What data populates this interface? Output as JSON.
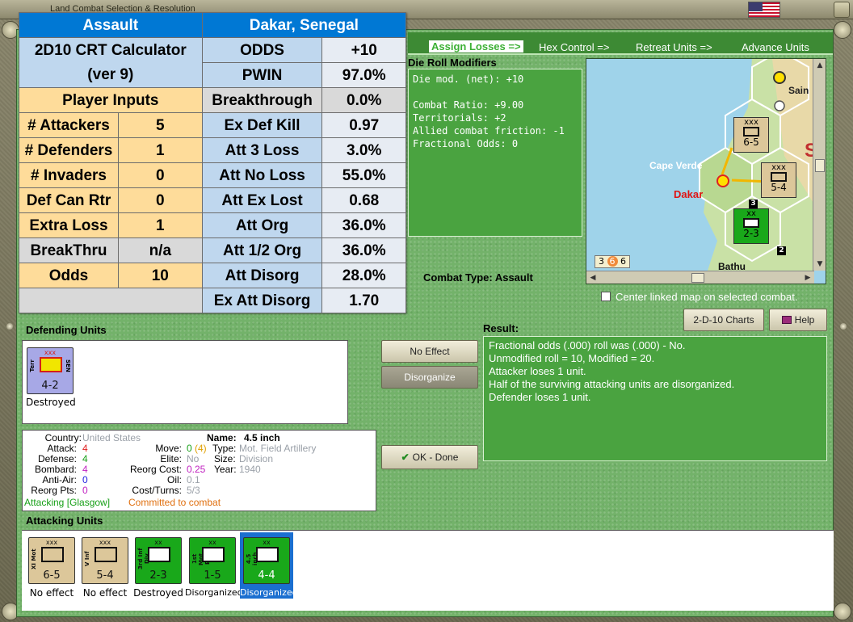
{
  "window": {
    "title": "Land Combat Selection & Resolution"
  },
  "steps": [
    {
      "label": "Assign Losses =>",
      "active": true
    },
    {
      "label": "Hex Control =>",
      "active": false
    },
    {
      "label": "Retreat Units =>",
      "active": false
    },
    {
      "label": "Advance Units",
      "active": false
    }
  ],
  "die_roll": {
    "heading": "Die Roll Modifiers",
    "lines": [
      "Die mod. (net): +10",
      "",
      "Combat Ratio: +9.00",
      "Territorials: +2",
      "Allied combat friction: -1",
      "Fractional Odds: 0"
    ]
  },
  "map": {
    "city_main": "Dakar",
    "city_island": "Cape Verde",
    "city_top": "Sain",
    "city_bottom": "Bathu",
    "big_letter": "S",
    "stack_left": "3",
    "stack_mid": "6",
    "stack_right": "6",
    "counter_a_size": "xxx",
    "counter_a_str": "6-5",
    "counter_b_size": "xxx",
    "counter_b_str": "5-4",
    "counter_c_size": "xx",
    "counter_c_str": "2-3",
    "marker_3": "3",
    "marker_2": "2"
  },
  "combat_type": "Combat Type:  Assault",
  "center_link_label": "Center linked map on selected combat.",
  "buttons": {
    "charts": "2-D-10 Charts",
    "help": "Help",
    "no_effect": "No Effect",
    "disorganize": "Disorganize",
    "ok_done": "OK - Done"
  },
  "result": {
    "heading": "Result:",
    "lines": [
      "Fractional odds (.000) roll was (.000)  - No.",
      "Unmodified roll = 10, Modified = 20.",
      "Attacker loses 1 unit.",
      "Half of the surviving attacking units are disorganized.",
      "Defender loses 1 unit."
    ]
  },
  "defending": {
    "heading": "Defending Units",
    "units": [
      {
        "size": "xxx",
        "side_left": "Terr",
        "side_right": "SEN",
        "strength": "4-2",
        "status": "Destroyed",
        "bg": "#a7a8e6",
        "sym_bg": "#f1e600",
        "sym_border": "#d4201b"
      }
    ]
  },
  "info": {
    "country_label": "Country:",
    "country": "United States",
    "attack_label": "Attack:",
    "attack": "4",
    "defense_label": "Defense:",
    "defense": "4",
    "bombard_label": "Bombard:",
    "bombard": "4",
    "antiair_label": "Anti-Air:",
    "antiair": "0",
    "reorg_label": "Reorg Pts:",
    "reorg": "0",
    "name_label": "Name:",
    "name": "4.5 inch",
    "move_label": "Move:",
    "move": "0",
    "move_max": "(4)",
    "type_label": "Type:",
    "type": "Mot. Field Artillery",
    "elite_label": "Elite:",
    "elite": "No",
    "size_label": "Size:",
    "size": "Division",
    "reorgcost_label": "Reorg Cost:",
    "reorgcost": "0.25",
    "year_label": "Year:",
    "year": "1940",
    "oil_label": "Oil:",
    "oil": "0.1",
    "costturns_label": "Cost/Turns:",
    "costturns": "5/3",
    "status_attacking": "Attacking [Glasgow]",
    "status_committed": "Committed to combat"
  },
  "attacking": {
    "heading": "Attacking Units",
    "units": [
      {
        "size": "xxx",
        "side": "XI Mot",
        "strength": "6-5",
        "status": "No effect",
        "bg": "#dcc79a",
        "selected": false
      },
      {
        "size": "xxx",
        "side": "V Inf",
        "strength": "5-4",
        "status": "No effect",
        "bg": "#dcc79a",
        "selected": false
      },
      {
        "size": "xx",
        "side": "3rd Inf Div",
        "strength": "2-3",
        "status": "Destroyed",
        "bg": "#19a81a",
        "selected": false
      },
      {
        "size": "xx",
        "side": "1st Mot Eng",
        "strength": "1-5",
        "status": "Disorganized",
        "bg": "#19a81a",
        "selected": false
      },
      {
        "size": "xx",
        "side": "4.5 inch",
        "strength": "4-4",
        "status": "Disorganized",
        "bg": "#19a81a",
        "selected": true
      }
    ]
  },
  "calculator": {
    "assault": "Assault",
    "location": "Dakar, Senegal",
    "title1": "2D10 CRT Calculator",
    "title2": "(ver 9)",
    "player_inputs": "Player Inputs",
    "rows": [
      {
        "l": "ODDS",
        "v": "+10"
      },
      {
        "l": "PWIN",
        "v": "97.0%"
      },
      {
        "l": "Breakthrough",
        "v": "0.0%"
      },
      {
        "l": "Ex Def Kill",
        "v": "0.97"
      },
      {
        "l": "Att 3 Loss",
        "v": "3.0%"
      },
      {
        "l": "Att No Loss",
        "v": "55.0%"
      },
      {
        "l": "Att Ex Lost",
        "v": "0.68"
      },
      {
        "l": "Att Org",
        "v": "36.0%"
      },
      {
        "l": "Att 1/2 Org",
        "v": "36.0%"
      },
      {
        "l": "Att Disorg",
        "v": "28.0%"
      },
      {
        "l": "Ex Att Disorg",
        "v": "1.70"
      }
    ],
    "inputs": [
      {
        "l": "# Attackers",
        "v": "5"
      },
      {
        "l": "# Defenders",
        "v": "1"
      },
      {
        "l": "# Invaders",
        "v": "0"
      },
      {
        "l": "Def Can Rtr",
        "v": "0"
      },
      {
        "l": "Extra Loss",
        "v": "1"
      },
      {
        "l": "BreakThru",
        "v": "n/a"
      },
      {
        "l": "Odds",
        "v": "10"
      }
    ]
  }
}
